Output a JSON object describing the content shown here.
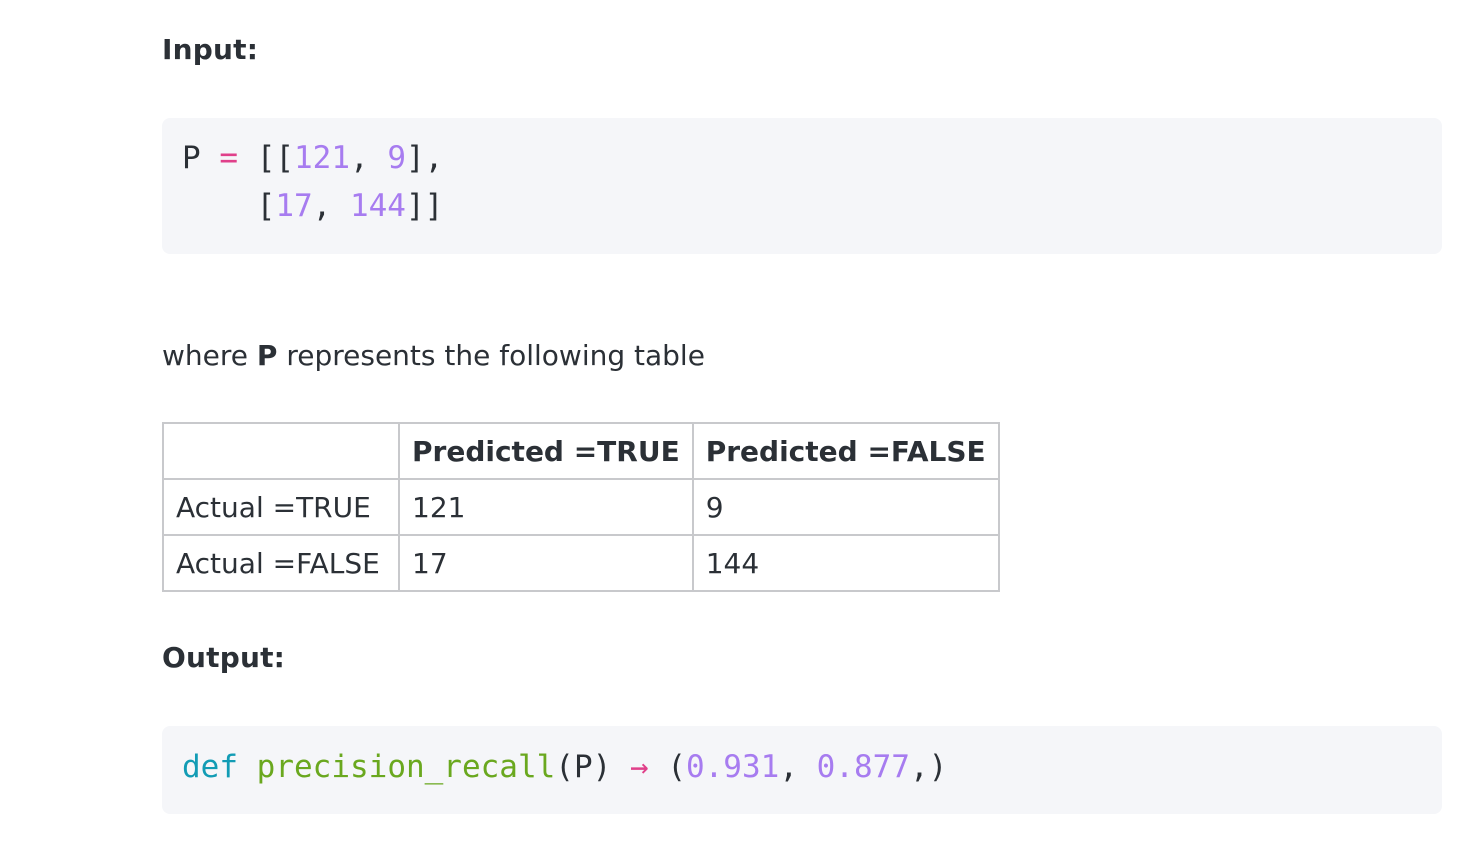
{
  "input_heading": "Input:",
  "input_code": {
    "line1": {
      "var": "P",
      "op": "=",
      "open": "[[",
      "n1": "121",
      "sep1": ", ",
      "n2": "9",
      "close": "],"
    },
    "line2": {
      "indent": "    ",
      "open": "[",
      "n1": "17",
      "sep1": ", ",
      "n2": "144",
      "close": "]]"
    }
  },
  "paragraph": {
    "before": "where ",
    "bold": "P",
    "after": " represents the following table"
  },
  "table": {
    "headers": [
      "",
      "Predicted =TRUE",
      "Predicted =FALSE"
    ],
    "rows": [
      [
        "Actual =TRUE",
        "121",
        "9"
      ],
      [
        "Actual =FALSE",
        "17",
        "144"
      ]
    ]
  },
  "output_heading": "Output:",
  "output_code": {
    "keyword": "def",
    "function": "precision_recall",
    "args": "(P)",
    "arrow": "→",
    "open": "(",
    "v1": "0.931",
    "sep": ", ",
    "v2": "0.877",
    "close": ",)"
  },
  "colors": {
    "text": "#2b3036",
    "code_bg": "#f5f6f9",
    "number": "#a77cf0",
    "operator": "#e0408a",
    "keyword": "#129cb5",
    "function": "#6aa81f",
    "table_border": "#c8c9cc"
  }
}
